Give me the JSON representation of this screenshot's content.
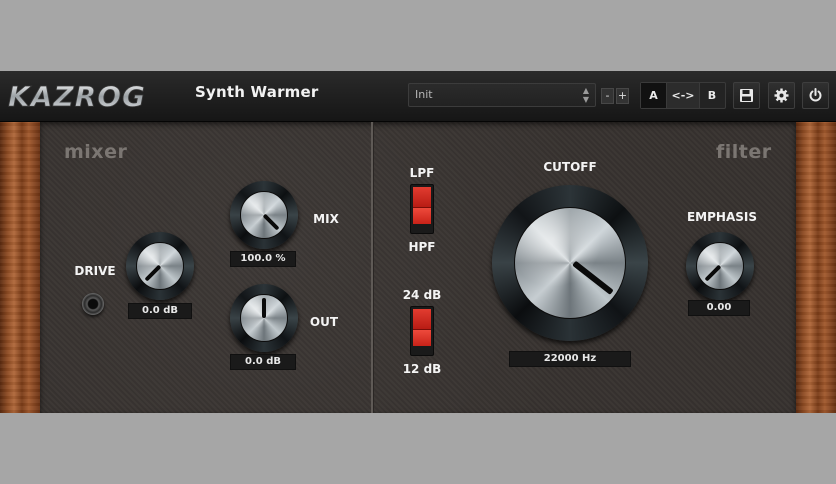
{
  "header": {
    "logo_text": "KAZROG",
    "plugin_name": "Synth Warmer",
    "preset": "Init",
    "preset_prev": "-",
    "preset_next": "+",
    "ab": {
      "a": "A",
      "copy": "<->",
      "b": "B",
      "active": "A"
    },
    "icons": [
      "save-icon",
      "gear-icon",
      "power-icon"
    ]
  },
  "mixer": {
    "title": "mixer",
    "drive": {
      "label": "DRIVE",
      "value": "0.0 dB"
    },
    "mix": {
      "label": "MIX",
      "value": "100.0 %"
    },
    "out": {
      "label": "OUT",
      "value": "0.0 dB"
    }
  },
  "filter": {
    "title": "filter",
    "type_switch": {
      "top": "LPF",
      "bottom": "HPF"
    },
    "slope_switch": {
      "top": "24 dB",
      "bottom": "12 dB"
    },
    "cutoff": {
      "label": "CUTOFF",
      "value": "22000 Hz"
    },
    "emphasis": {
      "label": "EMPHASIS",
      "value": "0.00"
    }
  },
  "colors": {
    "switch_red": "#d83228",
    "panel": "#383330",
    "header": "#1e1e1e"
  }
}
